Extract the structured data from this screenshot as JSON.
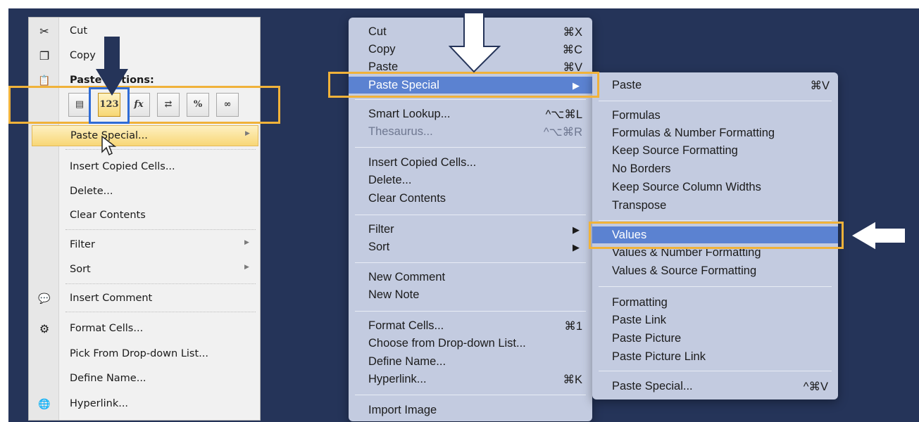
{
  "windows_menu": {
    "items": [
      {
        "label": "Cut",
        "icon": "scissors-icon",
        "glyph": "✂"
      },
      {
        "label": "Copy",
        "icon": "copy-icon",
        "glyph": "❐"
      },
      {
        "label": "Paste Options:",
        "icon": "clipboard-icon",
        "glyph": "📋"
      }
    ],
    "paste_icons": [
      {
        "name": "paste-icon",
        "glyph": "▤"
      },
      {
        "name": "values-123-icon",
        "glyph": "123"
      },
      {
        "name": "formulas-fx-icon",
        "glyph": "fx"
      },
      {
        "name": "transpose-icon",
        "glyph": "⇄"
      },
      {
        "name": "percent-formatting-icon",
        "glyph": "%"
      },
      {
        "name": "link-icon",
        "glyph": "∞"
      }
    ],
    "paste_special": "Paste Special...",
    "more_items": [
      {
        "label": "Insert Copied Cells..."
      },
      {
        "label": "Delete..."
      },
      {
        "label": "Clear Contents"
      },
      {
        "label": "Filter"
      },
      {
        "label": "Sort"
      },
      {
        "label": "Insert Comment",
        "icon": "comment-icon",
        "glyph": "💬"
      },
      {
        "label": "Format Cells...",
        "icon": "format-cells-icon",
        "glyph": "⚙"
      },
      {
        "label": "Pick From Drop-down List..."
      },
      {
        "label": "Define Name..."
      },
      {
        "label": "Hyperlink...",
        "icon": "hyperlink-icon",
        "glyph": "🌐"
      }
    ]
  },
  "mac_menu": {
    "items": [
      {
        "label": "Cut",
        "shortcut": "⌘X"
      },
      {
        "label": "Copy",
        "shortcut": "⌘C"
      },
      {
        "label": "Paste",
        "shortcut": "⌘V"
      },
      {
        "label": "Paste Special",
        "shortcut": "▶"
      },
      {
        "label": "Smart Lookup...",
        "shortcut": "^⌥⌘L"
      },
      {
        "label": "Thesaurus...",
        "shortcut": "^⌥⌘R"
      },
      {
        "label": "Insert Copied Cells..."
      },
      {
        "label": "Delete..."
      },
      {
        "label": "Clear Contents"
      },
      {
        "label": "Filter",
        "shortcut": "▶"
      },
      {
        "label": "Sort",
        "shortcut": "▶"
      },
      {
        "label": "New Comment"
      },
      {
        "label": "New Note"
      },
      {
        "label": "Format Cells...",
        "shortcut": "⌘1"
      },
      {
        "label": "Choose from Drop-down List..."
      },
      {
        "label": "Define Name..."
      },
      {
        "label": "Hyperlink...",
        "shortcut": "⌘K"
      },
      {
        "label": "Import Image"
      }
    ]
  },
  "mac_submenu": {
    "items": [
      {
        "label": "Paste",
        "shortcut": "⌘V"
      },
      {
        "label": "Formulas"
      },
      {
        "label": "Formulas & Number Formatting"
      },
      {
        "label": "Keep Source Formatting"
      },
      {
        "label": "No Borders"
      },
      {
        "label": "Keep Source Column Widths"
      },
      {
        "label": "Transpose"
      },
      {
        "label": "Values"
      },
      {
        "label": "Values & Number Formatting"
      },
      {
        "label": "Values & Source Formatting"
      },
      {
        "label": "Formatting"
      },
      {
        "label": "Paste Link"
      },
      {
        "label": "Paste Picture"
      },
      {
        "label": "Paste Picture Link"
      },
      {
        "label": "Paste Special...",
        "shortcut": "^⌘V"
      }
    ]
  },
  "colors": {
    "background": "#253459",
    "highlight_box": "#f0b23a",
    "selection_box": "#2e6bd6",
    "mac_selected": "#5b82d1"
  }
}
